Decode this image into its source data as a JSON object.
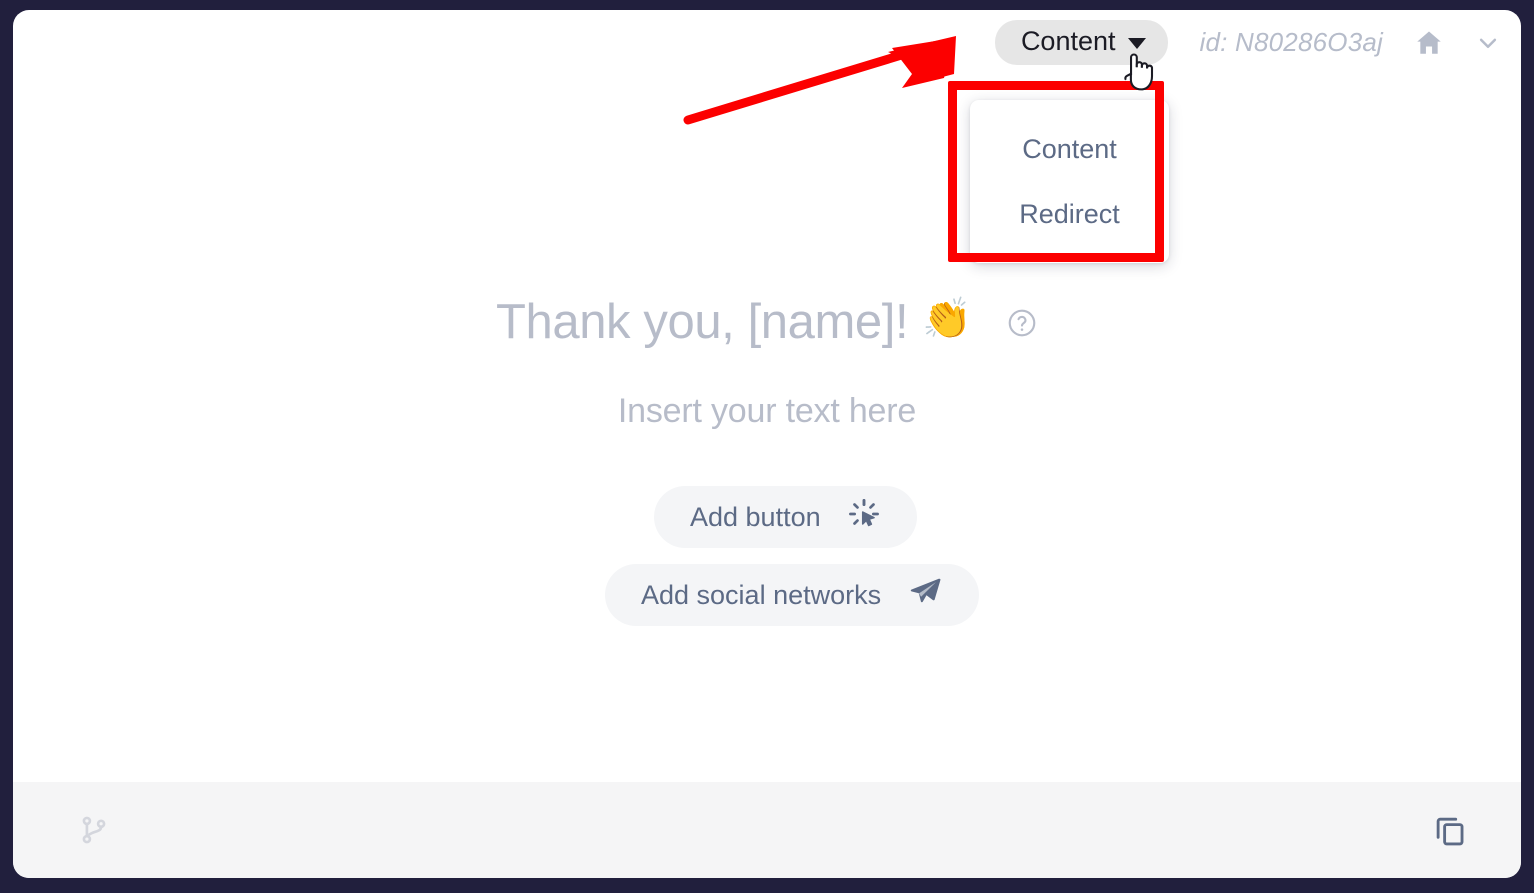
{
  "window": {
    "outer_background": "#211f3d",
    "card_background": "#ffffff"
  },
  "topbar": {
    "type_select_label": "Content",
    "type_select_background": "#e6e6e6",
    "page_id": "id: N80286O3aj",
    "home_icon": "home-icon",
    "chevron_icon": "chevron-down-icon"
  },
  "dropdown": {
    "visible": true,
    "items": [
      {
        "label": "Content"
      },
      {
        "label": "Redirect"
      }
    ]
  },
  "annotation": {
    "color": "#fc0000",
    "arrow": "red-arrow-pointing-to-content-dropdown",
    "box": "red-highlight-box-around-dropdown-menu"
  },
  "cursor": {
    "glyph": "pointing-hand-cursor"
  },
  "main": {
    "headline": "Thank you, [name]!",
    "headline_emoji": "👏",
    "help_icon": "help-circle-icon",
    "subline": "Insert your text here",
    "buttons": [
      {
        "label": "Add button",
        "icon": "cursor-click-icon"
      },
      {
        "label": "Add social networks",
        "icon": "send-plane-icon"
      }
    ]
  },
  "footer": {
    "background": "#f5f5f6",
    "left_icon": "git-branch-icon",
    "right_icon": "copy-duplicate-icon"
  },
  "colors": {
    "placeholder_text": "#b7bcc9",
    "slate_text": "#5c6a85",
    "dark_text": "#1b1b24",
    "pill_background": "#f4f5f7"
  }
}
